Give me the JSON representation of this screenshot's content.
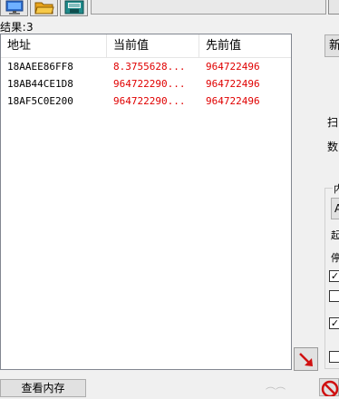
{
  "toolbar": {
    "icons": [
      "computer-icon",
      "folder-open-icon",
      "save-icon"
    ],
    "progress_fraction": 0.0
  },
  "results": {
    "count_label": "结果:3"
  },
  "table": {
    "columns": [
      "地址",
      "当前值",
      "先前值"
    ],
    "rows": [
      {
        "address": "18AAEE86FF8",
        "current": "8.3755628...",
        "previous": "964722496"
      },
      {
        "address": "18AB44CE1D8",
        "current": "964722290...",
        "previous": "964722496"
      },
      {
        "address": "18AF5C0E200",
        "current": "964722290...",
        "previous": "964722496"
      }
    ],
    "value_color": "#e00000"
  },
  "side_panel": {
    "first_scan_button": "新",
    "scan_type_label": "扫",
    "value_type_label": "数",
    "options_group_title": "内",
    "small_button": "A",
    "option_1_label": "起",
    "option_2_label": "停",
    "checkboxes": [
      true,
      false,
      true,
      false
    ]
  },
  "bottom": {
    "view_memory_button": "查看内存"
  }
}
